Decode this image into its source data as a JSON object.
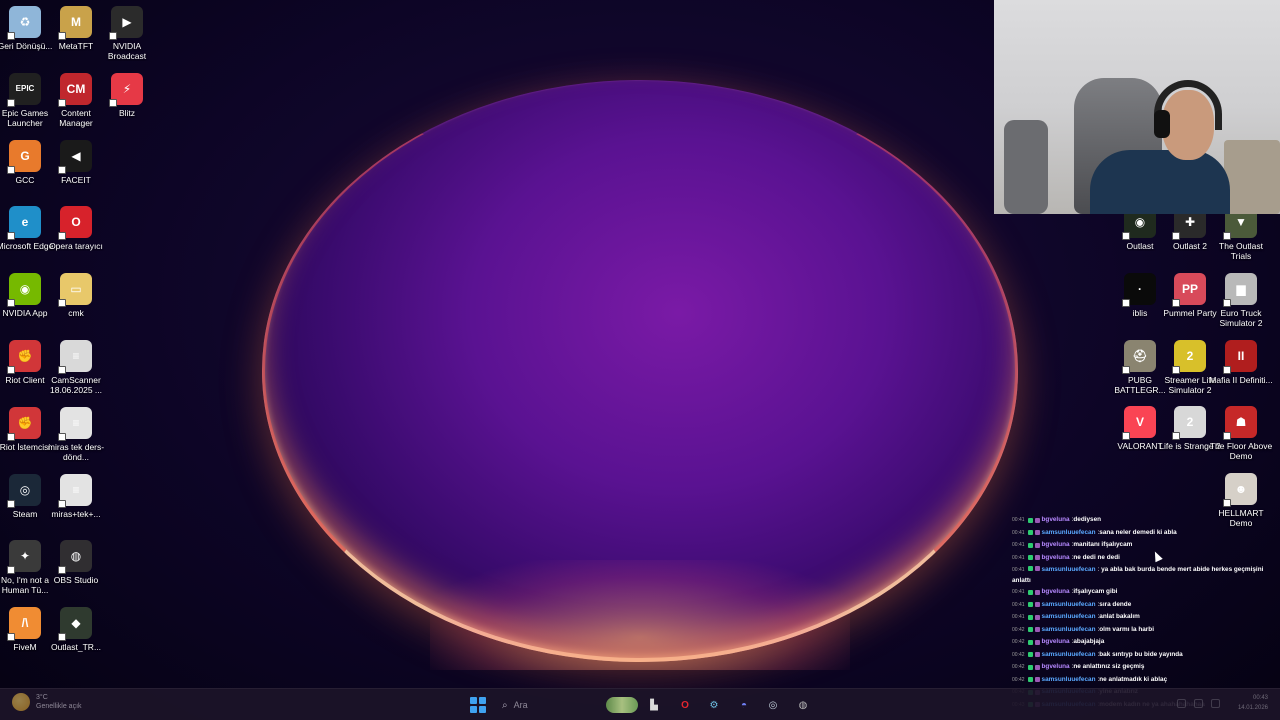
{
  "desktop_left": [
    {
      "label": "Geri Dönüşü...",
      "icon": "recycle-bin-icon",
      "color": "#8fb6d9",
      "glyph": "♻"
    },
    {
      "label": "MetaTFT",
      "icon": "metatft-icon",
      "color": "#c9a24a",
      "glyph": "M"
    },
    {
      "label": "NVIDIA Broadcast",
      "icon": "nvidia-broadcast-icon",
      "color": "#2b2b2b",
      "glyph": "▶"
    },
    {
      "label": "Epic Games Launcher",
      "icon": "epic-games-icon",
      "color": "#202020",
      "glyph": "EPIC"
    },
    {
      "label": "Content Manager",
      "icon": "content-manager-icon",
      "color": "#c0272d",
      "glyph": "CM"
    },
    {
      "label": "Blitz",
      "icon": "blitz-icon",
      "color": "#e63946",
      "glyph": "⚡"
    },
    {
      "label": "GCC",
      "icon": "gcc-icon",
      "color": "#e87a2c",
      "glyph": "G"
    },
    {
      "label": "FACEIT",
      "icon": "faceit-icon",
      "color": "#1a1a1a",
      "glyph": "◀"
    },
    {
      "label": "Microsoft Edge",
      "icon": "edge-icon",
      "color": "#1f8fc9",
      "glyph": "e"
    },
    {
      "label": "Opera tarayıcı",
      "icon": "opera-icon",
      "color": "#d7222b",
      "glyph": "O"
    },
    {
      "label": "NVIDIA App",
      "icon": "nvidia-app-icon",
      "color": "#76b900",
      "glyph": "◉"
    },
    {
      "label": "cmk",
      "icon": "folder-icon",
      "color": "#e8c86a",
      "glyph": "▭"
    },
    {
      "label": "Riot Client",
      "icon": "riot-client-icon",
      "color": "#d13639",
      "glyph": "✊"
    },
    {
      "label": "CamScanner 18.06.2025 ...",
      "icon": "document-icon",
      "color": "#d9d9d9",
      "glyph": "≡"
    },
    {
      "label": "Riot İstemcisi",
      "icon": "riot-istemcisi-icon",
      "color": "#d13639",
      "glyph": "✊"
    },
    {
      "label": "miras tek ders-dönd...",
      "icon": "document-icon",
      "color": "#e3e3e3",
      "glyph": "≡"
    },
    {
      "label": "Steam",
      "icon": "steam-icon",
      "color": "#1b2838",
      "glyph": "◎"
    },
    {
      "label": "miras+tek+...",
      "icon": "document-icon",
      "color": "#e3e3e3",
      "glyph": "≡"
    },
    {
      "label": "No, I'm not a Human Tü...",
      "icon": "game-icon",
      "color": "#3a3a3a",
      "glyph": "✦"
    },
    {
      "label": "OBS Studio",
      "icon": "obs-icon",
      "color": "#302e31",
      "glyph": "◍"
    },
    {
      "label": "FiveM",
      "icon": "fivem-icon",
      "color": "#f08c33",
      "glyph": "/\\"
    },
    {
      "label": "Outlast_TR...",
      "icon": "outlast-tr-icon",
      "color": "#2f3a2f",
      "glyph": "◆"
    }
  ],
  "desktop_right": [
    {
      "label": "Outlast",
      "icon": "outlast-icon",
      "color": "#1f2a1e",
      "glyph": "◉"
    },
    {
      "label": "Outlast 2",
      "icon": "outlast-2-icon",
      "color": "#2a2a2a",
      "glyph": "✚"
    },
    {
      "label": "The Outlast Trials",
      "icon": "outlast-trials-icon",
      "color": "#4b5a3a",
      "glyph": "▼"
    },
    {
      "label": "iblis",
      "icon": "iblis-icon",
      "color": "#0a0a0a",
      "glyph": "·"
    },
    {
      "label": "Pummel Party",
      "icon": "pummel-party-icon",
      "color": "#d84a5a",
      "glyph": "PP"
    },
    {
      "label": "Euro Truck Simulator 2",
      "icon": "euro-truck-icon",
      "color": "#b9b9b9",
      "glyph": "▆"
    },
    {
      "label": "PUBG BATTLEGR...",
      "icon": "pubg-icon",
      "color": "#8a8470",
      "glyph": "⛑"
    },
    {
      "label": "Streamer Life Simulator 2",
      "icon": "streamer-life-icon",
      "color": "#d8c02a",
      "glyph": "2"
    },
    {
      "label": "Mafia II Definiti...",
      "icon": "mafia-icon",
      "color": "#b01e1e",
      "glyph": "II"
    },
    {
      "label": "VALORANT",
      "icon": "valorant-icon",
      "color": "#fa4454",
      "glyph": "V"
    },
    {
      "label": "Life is Strange 2",
      "icon": "life-is-strange-icon",
      "color": "#d8d8d8",
      "glyph": "2"
    },
    {
      "label": "The Floor Above Demo",
      "icon": "floor-above-icon",
      "color": "#c62828",
      "glyph": "☗"
    },
    {
      "label": "HELLMART Demo",
      "icon": "hellmart-icon",
      "color": "#d6d0c8",
      "glyph": "☻"
    }
  ],
  "chat": [
    {
      "time": "00:41",
      "user": "bgveluna",
      "user_color": "purple",
      "msg": "dediysen"
    },
    {
      "time": "00:41",
      "user": "samsunluuefecan",
      "user_color": "blue",
      "msg": "sana neler demedi ki abla"
    },
    {
      "time": "00:41",
      "user": "bgveluna",
      "user_color": "purple",
      "msg": "manitanı ifşalıycam"
    },
    {
      "time": "00:41",
      "user": "bgveluna",
      "user_color": "purple",
      "msg": "ne dedi ne dedi"
    },
    {
      "time": "00:41",
      "user": "samsunluuefecan",
      "user_color": "blue",
      "msg": "ya abla bak burda bende mert abide herkes geçmişini anlattı",
      "wrap": true
    },
    {
      "time": "00:41",
      "user": "bgveluna",
      "user_color": "purple",
      "msg": "ifşalıycam gibi"
    },
    {
      "time": "00:41",
      "user": "samsunluuefecan",
      "user_color": "blue",
      "msg": "sıra dende"
    },
    {
      "time": "00:41",
      "user": "samsunluuefecan",
      "user_color": "blue",
      "msg": "anlat bakalım"
    },
    {
      "time": "00:42",
      "user": "samsunluuefecan",
      "user_color": "blue",
      "msg": "olm varmı la harbi"
    },
    {
      "time": "00:42",
      "user": "bgveluna",
      "user_color": "purple",
      "msg": "abajabjaja"
    },
    {
      "time": "00:42",
      "user": "samsunluuefecan",
      "user_color": "blue",
      "msg": "bak sıntıyp bu bide yayında"
    },
    {
      "time": "00:42",
      "user": "bgveluna",
      "user_color": "purple",
      "msg": "ne anlattınız siz geçmiş"
    },
    {
      "time": "00:42",
      "user": "samsunluuefecan",
      "user_color": "blue",
      "msg": "ne anlatmadık ki ablaç"
    },
    {
      "time": "00:42",
      "user": "samsunluuefecan",
      "user_color": "blue",
      "msg": "yine anlatırız"
    },
    {
      "time": "00:43",
      "user": "samsunluuefecan",
      "user_color": "blue",
      "msg": "modem kadın ne ya ahahahahahaa"
    }
  ],
  "taskbar": {
    "weather_temp": "3°C",
    "weather_text": "Genellikle açık",
    "search_placeholder": "Ara",
    "clock_time": "00:43",
    "clock_date": "14.01.2026",
    "accent": "#3fa2f0"
  }
}
